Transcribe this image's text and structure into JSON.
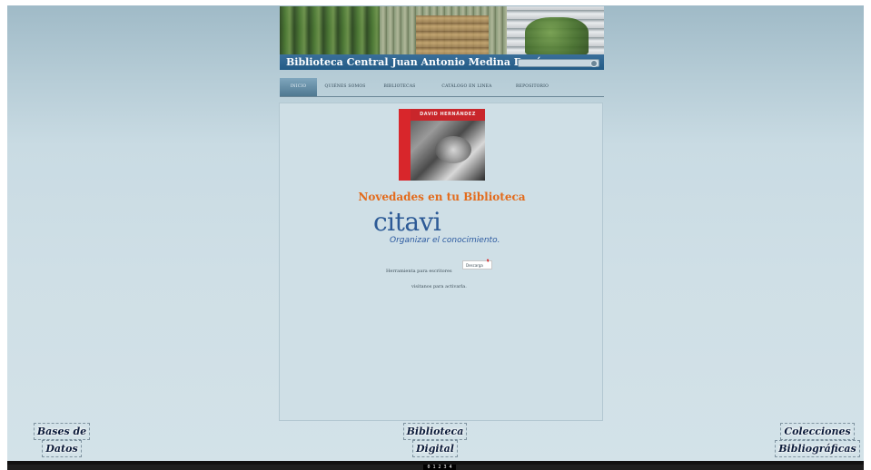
{
  "header": {
    "title": "Biblioteca Central Juan Antonio Medina Durón",
    "search_placeholder": ""
  },
  "nav": {
    "items": [
      {
        "label": "INICIO",
        "active": true
      },
      {
        "label": "QUIÉNES SOMOS",
        "active": false
      },
      {
        "label": "BIBLIOTECAS",
        "active": false
      },
      {
        "label": "CATÁLOGO EN LINEA",
        "active": false
      },
      {
        "label": "REPOSITORIO",
        "active": false
      }
    ]
  },
  "main": {
    "book_author": "DAVID HERNÁNDEZ",
    "novedades_title": "Novedades en tu Biblioteca",
    "citavi_logo": "citavi",
    "citavi_tagline": "Organizar el conocimiento.",
    "tool_text": "Herramienta para escritores",
    "download_label": "Descarga",
    "visit_text": "visitanos para activarla."
  },
  "footer_links": {
    "bases_line1": "Bases de",
    "bases_line2": "Datos",
    "digital_line1": "Biblioteca",
    "digital_line2": "Digital",
    "colecciones_line1": "Colecciones",
    "colecciones_line2": "Bibliográficas"
  },
  "counter": "0 1 2 3 4",
  "colors": {
    "accent_orange": "#e36b1c",
    "header_bar": "#235b86",
    "citavi_blue": "#2c5a96",
    "citavi_red": "#d82a2a"
  }
}
